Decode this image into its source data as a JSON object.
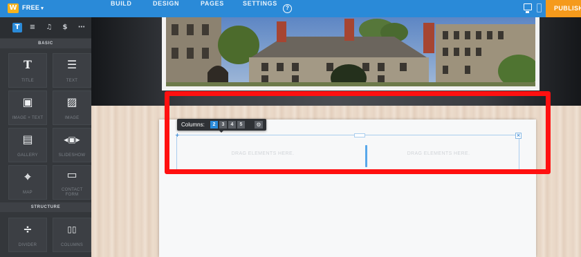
{
  "topbar": {
    "logo_glyph": "W",
    "plan_label": "FREE",
    "nav": [
      "BUILD",
      "DESIGN",
      "PAGES",
      "SETTINGS"
    ],
    "help_glyph": "?",
    "publish_label": "PUBLISH",
    "colors": {
      "bar": "#2a8ad8",
      "publish": "#f59a1c",
      "logo": "#f7b21b"
    }
  },
  "sidebar": {
    "tabs": [
      {
        "icon": "text-tab-icon",
        "glyph": "T"
      },
      {
        "icon": "layout-tab-icon",
        "glyph": "≡"
      },
      {
        "icon": "music-tab-icon",
        "glyph": "♫"
      },
      {
        "icon": "store-tab-icon",
        "glyph": "$"
      },
      {
        "icon": "more-tab-icon",
        "glyph": "⋯"
      }
    ],
    "basic_header": "BASIC",
    "basic": [
      {
        "label": "TITLE",
        "icon": "title-icon",
        "glyph": "T"
      },
      {
        "label": "TEXT",
        "icon": "text-icon",
        "glyph": "☰"
      },
      {
        "label": "IMAGE + TEXT",
        "icon": "image-text-icon",
        "glyph": "▣"
      },
      {
        "label": "IMAGE",
        "icon": "image-icon",
        "glyph": "▨"
      },
      {
        "label": "GALLERY",
        "icon": "gallery-icon",
        "glyph": "▤"
      },
      {
        "label": "SLIDESHOW",
        "icon": "slideshow-icon",
        "glyph": "◂▣▸"
      },
      {
        "label": "MAP",
        "icon": "map-pin-icon",
        "glyph": "⌖"
      },
      {
        "label": "CONTACT FORM",
        "icon": "contact-form-icon",
        "glyph": "▭"
      }
    ],
    "structure_header": "STRUCTURE",
    "structure": [
      {
        "label": "DIVIDER",
        "icon": "divider-icon",
        "glyph": "÷"
      },
      {
        "label": "COLUMNS",
        "icon": "columns-icon",
        "glyph": "▯▯"
      }
    ]
  },
  "editor": {
    "columns_toolbar": {
      "label": "Columns:",
      "options": [
        "2",
        "3",
        "4",
        "5"
      ],
      "selected": "2",
      "settings_glyph": "⚙"
    },
    "drop_zones": [
      "DRAG ELEMENTS HERE.",
      "DRAG ELEMENTS HERE."
    ],
    "close_glyph": "×",
    "move_glyph": "+"
  },
  "annotation": {
    "color": "#ff1010"
  }
}
